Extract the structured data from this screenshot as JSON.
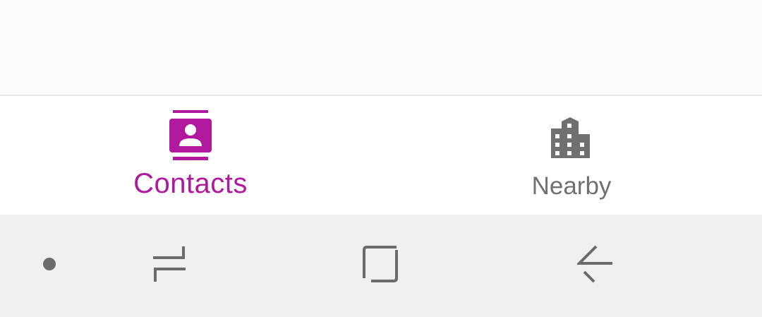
{
  "colors": {
    "accent": "#b0199e",
    "inactive": "#707070",
    "system_icon": "#6b6b6b"
  },
  "bottom_nav": {
    "tabs": [
      {
        "id": "contacts",
        "label": "Contacts",
        "icon": "contacts-book-icon",
        "selected": true
      },
      {
        "id": "nearby",
        "label": "Nearby",
        "icon": "building-icon",
        "selected": false
      }
    ]
  },
  "system_nav": {
    "buttons": [
      {
        "id": "dot",
        "icon": "dot-icon"
      },
      {
        "id": "recents",
        "icon": "recents-icon"
      },
      {
        "id": "home",
        "icon": "home-square-icon"
      },
      {
        "id": "back",
        "icon": "back-arrow-icon"
      }
    ]
  }
}
